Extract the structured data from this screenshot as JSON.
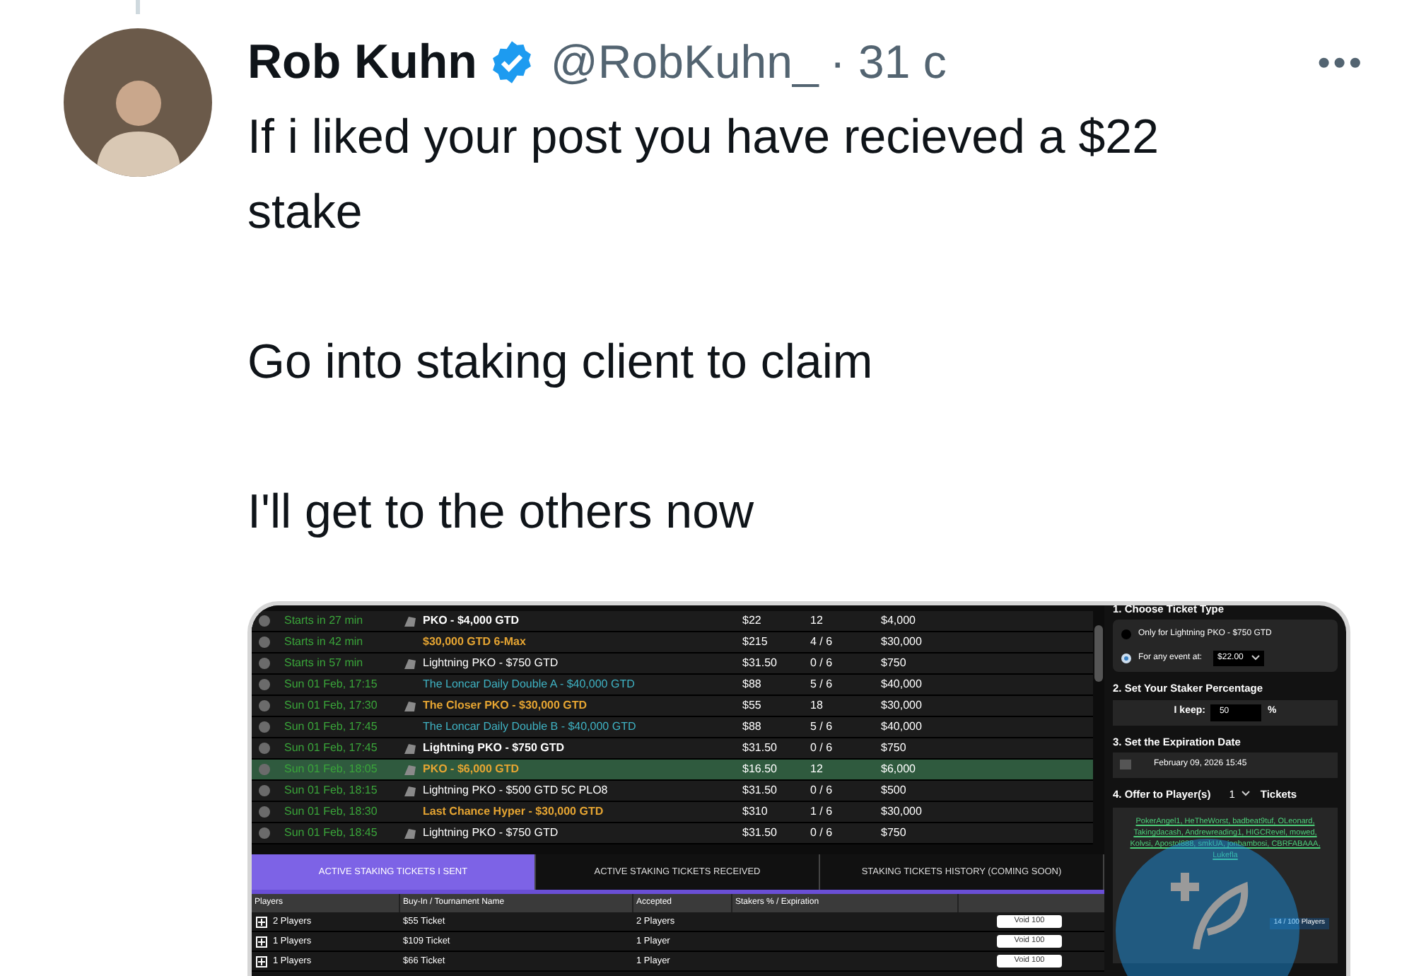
{
  "tweet": {
    "name": "Rob Kuhn",
    "verified": true,
    "handle": "@RobKuhn_",
    "time": "· 31 c",
    "more": "•••",
    "paragraphs": [
      "If i liked your post you have recieved a $22 stake",
      "Go into staking client to claim",
      "I'll get to the others now"
    ]
  },
  "screenshot": {
    "tournaments": [
      {
        "start": "Starts in 27 min",
        "icon": true,
        "name": "PKO - $4,000 GTD",
        "color": "#ffffff",
        "bold": true,
        "buyin": "$22",
        "entries": "12",
        "gtd": "$4,000",
        "selected": false
      },
      {
        "start": "Starts in 42 min",
        "icon": false,
        "name": "$30,000 GTD 6-Max",
        "color": "#e6a532",
        "bold": true,
        "buyin": "$215",
        "entries": "4 / 6",
        "gtd": "$30,000",
        "selected": false
      },
      {
        "start": "Starts in 57 min",
        "icon": true,
        "name": "Lightning PKO - $750 GTD",
        "color": "#ffffff",
        "bold": false,
        "buyin": "$31.50",
        "entries": "0 / 6",
        "gtd": "$750",
        "selected": false
      },
      {
        "start": "Sun 01 Feb, 17:15",
        "icon": false,
        "name": "The Loncar Daily Double A - $40,000 GTD",
        "color": "#3fb3c4",
        "bold": false,
        "buyin": "$88",
        "entries": "5 / 6",
        "gtd": "$40,000",
        "selected": false
      },
      {
        "start": "Sun 01 Feb, 17:30",
        "icon": true,
        "name": "The Closer PKO - $30,000 GTD",
        "color": "#e6a532",
        "bold": true,
        "buyin": "$55",
        "entries": "18",
        "gtd": "$30,000",
        "selected": false
      },
      {
        "start": "Sun 01 Feb, 17:45",
        "icon": false,
        "name": "The Loncar Daily Double B - $40,000 GTD",
        "color": "#3fb3c4",
        "bold": false,
        "buyin": "$88",
        "entries": "5 / 6",
        "gtd": "$40,000",
        "selected": false
      },
      {
        "start": "Sun 01 Feb, 17:45",
        "icon": true,
        "name": "Lightning PKO - $750 GTD",
        "color": "#ffffff",
        "bold": true,
        "buyin": "$31.50",
        "entries": "0 / 6",
        "gtd": "$750",
        "selected": false
      },
      {
        "start": "Sun 01 Feb, 18:05",
        "icon": true,
        "name": "PKO - $6,000 GTD",
        "color": "#e6a532",
        "bold": true,
        "buyin": "$16.50",
        "entries": "12",
        "gtd": "$6,000",
        "selected": true
      },
      {
        "start": "Sun 01 Feb, 18:15",
        "icon": true,
        "name": "Lightning PKO - $500 GTD 5C PLO8",
        "color": "#ffffff",
        "bold": false,
        "buyin": "$31.50",
        "entries": "0 / 6",
        "gtd": "$500",
        "selected": false
      },
      {
        "start": "Sun 01 Feb, 18:30",
        "icon": false,
        "name": "Last Chance Hyper - $30,000 GTD",
        "color": "#e6a532",
        "bold": true,
        "buyin": "$310",
        "entries": "1 / 6",
        "gtd": "$30,000",
        "selected": false
      },
      {
        "start": "Sun 01 Feb, 18:45",
        "icon": true,
        "name": "Lightning PKO - $750 GTD",
        "color": "#ffffff",
        "bold": false,
        "buyin": "$31.50",
        "entries": "0 / 6",
        "gtd": "$750",
        "selected": false
      }
    ],
    "tabs": [
      {
        "label": "ACTIVE STAKING TICKETS I SENT",
        "selected": true
      },
      {
        "label": "ACTIVE STAKING TICKETS RECEIVED",
        "selected": false
      },
      {
        "label": "STAKING TICKETS HISTORY (COMING SOON)",
        "selected": false
      }
    ],
    "table": {
      "columns": [
        "Players",
        "Buy-In / Tournament Name",
        "Accepted",
        "Stakers % / Expiration"
      ],
      "rows": [
        {
          "players": "2 Players",
          "ticket": "$55 Ticket",
          "accepted": "2 Players",
          "action": "Void 100"
        },
        {
          "players": "1 Players",
          "ticket": "$109 Ticket",
          "accepted": "1 Player",
          "action": "Void 100"
        },
        {
          "players": "1 Players",
          "ticket": "$66 Ticket",
          "accepted": "1 Player",
          "action": "Void 100"
        }
      ]
    },
    "panel": {
      "step1": "1. Choose Ticket Type",
      "options": [
        {
          "label": "Only for Lightning PKO - $750 GTD",
          "selected": false
        },
        {
          "label": "For any event at:",
          "selected": true
        }
      ],
      "event_amount": "$22.00",
      "step2": "2. Set Your Staker Percentage",
      "keep_label": "I keep:",
      "keep_value": "50",
      "percent": "%",
      "step3": "3. Set the Expiration Date",
      "expiration": "February 09, 2026 15:45",
      "step4": "4. Offer to Player(s)",
      "tickets_value": "1",
      "tickets_label": "Tickets",
      "players": "PokerAngel1, HeTheWorst, badbeat9tuf, OLeonard, Takingdacash, Andrewreading1, HIGCRevel, mowed, Kolvsi, Apostol888, smkUA, jonbambosi, CBRFABAAA, Lukefla",
      "player_count": "14 / 100 Players"
    }
  }
}
